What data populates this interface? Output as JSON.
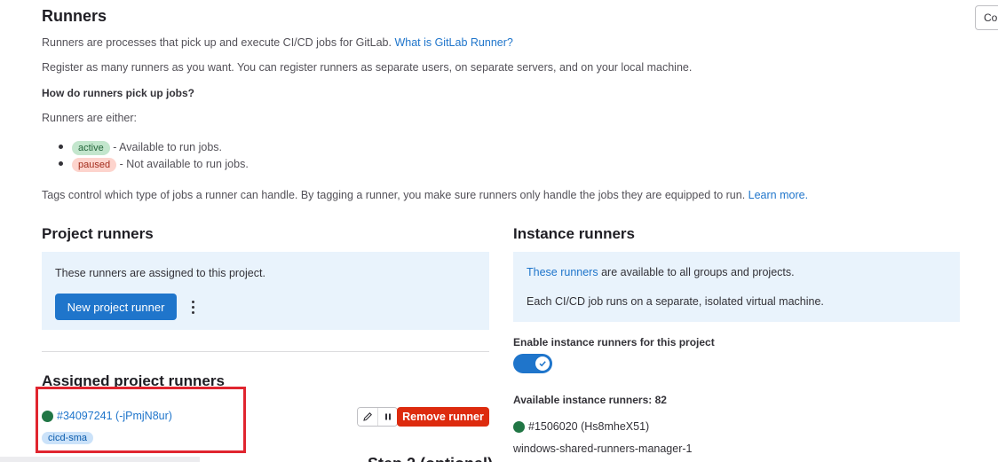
{
  "page": {
    "title": "Runners",
    "intro_text": "Runners are processes that pick up and execute CI/CD jobs for GitLab.",
    "intro_link": "What is GitLab Runner?",
    "register_text": "Register as many runners as you want. You can register runners as separate users, on separate servers, and on your local machine.",
    "how_heading": "How do runners pick up jobs?",
    "either_text": "Runners are either:",
    "states": [
      {
        "badge": "active",
        "description": "- Available to run jobs."
      },
      {
        "badge": "paused",
        "description": "- Not available to run jobs."
      }
    ],
    "tags_text": "Tags control which type of jobs a runner can handle. By tagging a runner, you make sure runners only handle the jobs they are equipped to run.",
    "tags_link": "Learn more.",
    "corner_button": "Co"
  },
  "project_runners": {
    "heading": "Project runners",
    "panel_text": "These runners are assigned to this project.",
    "new_button": "New project runner",
    "assigned_heading": "Assigned project runners",
    "runner": {
      "id_label": "#34097241 (-jPmjN8ur)",
      "tag": "cicd-sma",
      "remove_button": "Remove runner"
    },
    "bottom_heading_partial": "Step 2 (optional)"
  },
  "instance_runners": {
    "heading": "Instance runners",
    "panel_link": "These runners",
    "panel_text": "are available to all groups and projects.",
    "panel_text2": "Each CI/CD job runs on a separate, isolated virtual machine.",
    "enable_label": "Enable instance runners for this project",
    "enabled": true,
    "available_label": "Available instance runners: 82",
    "runner": {
      "id_label": "#1506020 (Hs8mheX51)",
      "name": "windows-shared-runners-manager-1"
    }
  },
  "colors": {
    "accent": "#1f75cb",
    "danger": "#dd2b0e",
    "online": "#217645",
    "highlight": "#e0252f"
  }
}
